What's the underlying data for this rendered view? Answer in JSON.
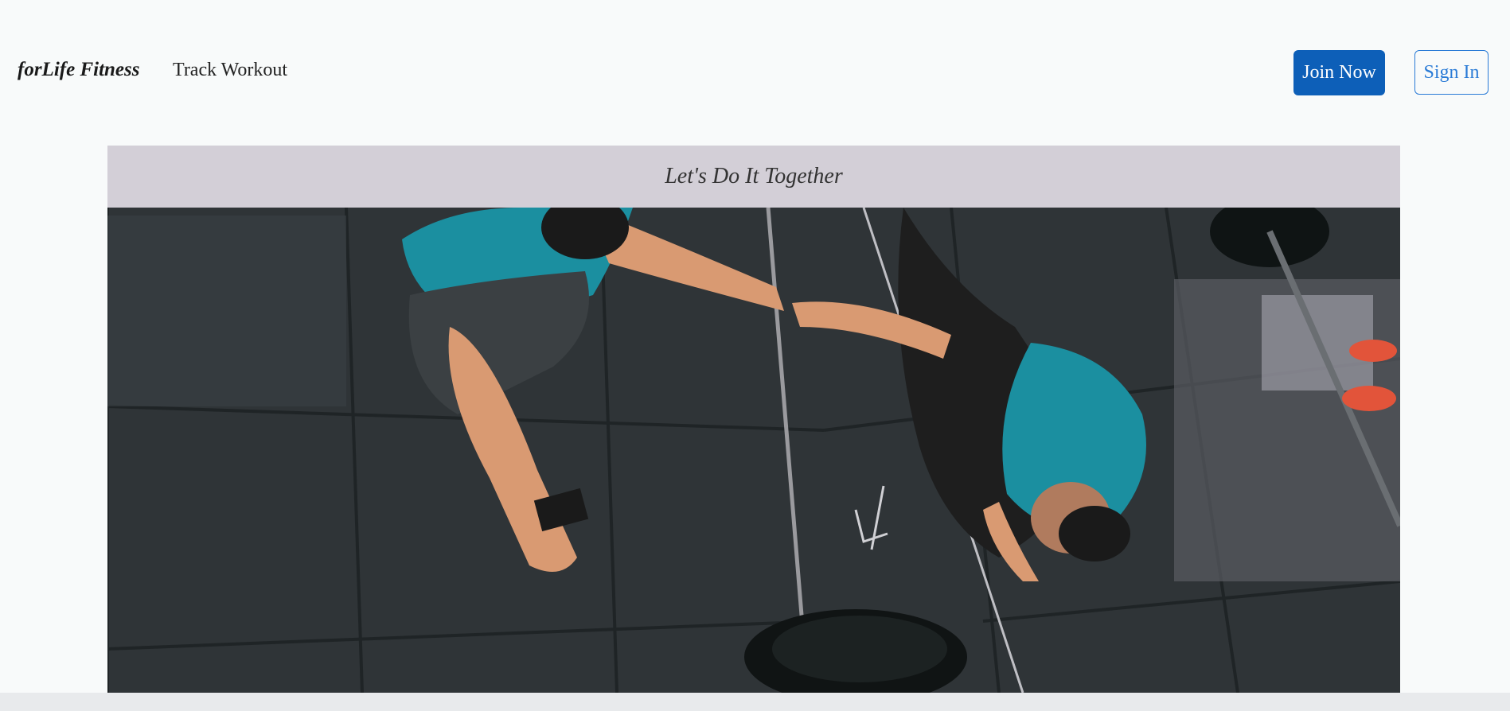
{
  "nav": {
    "brand": "forLife Fitness",
    "links": [
      "Track Workout"
    ],
    "join_label": "Join Now",
    "signin_label": "Sign In"
  },
  "hero": {
    "banner_text": "Let's Do It Together",
    "photo": "two-athletes-fist-bump-gym-floor"
  },
  "colors": {
    "primary": "#0d5fb8",
    "outline": "#2a7bd6",
    "banner_bg": "#d3cfd7",
    "page_bg": "#f8fafa"
  }
}
